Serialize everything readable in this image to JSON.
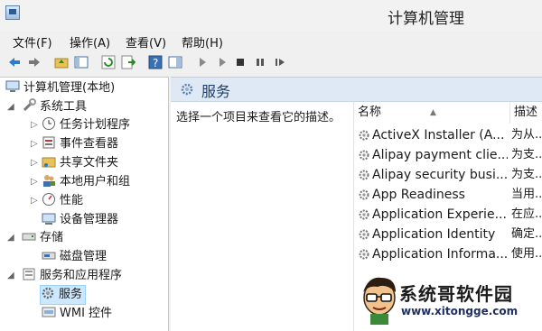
{
  "window": {
    "title": "计算机管理"
  },
  "menu": [
    "文件(F)",
    "操作(A)",
    "查看(V)",
    "帮助(H)"
  ],
  "tree": {
    "root": "计算机管理(本地)",
    "system_tools": "系统工具",
    "task_scheduler": "任务计划程序",
    "event_viewer": "事件查看器",
    "shared_folders": "共享文件夹",
    "local_users": "本地用户和组",
    "performance": "性能",
    "device_manager": "设备管理器",
    "storage": "存储",
    "disk_management": "磁盘管理",
    "services_apps": "服务和应用程序",
    "services": "服务",
    "wmi": "WMI 控件"
  },
  "services_panel": {
    "title": "服务",
    "description": "选择一个项目来查看它的描述。",
    "columns": {
      "name": "名称",
      "desc": "描述"
    },
    "rows": [
      {
        "name": "ActiveX Installer (A...",
        "desc": "为从..."
      },
      {
        "name": "Alipay payment clie...",
        "desc": "为支..."
      },
      {
        "name": "Alipay security busi...",
        "desc": "为支..."
      },
      {
        "name": "App Readiness",
        "desc": "当用..."
      },
      {
        "name": "Application Experie...",
        "desc": "在应..."
      },
      {
        "name": "Application Identity",
        "desc": "确定..."
      },
      {
        "name": "Application Informa...",
        "desc": "使用..."
      }
    ]
  },
  "watermark": {
    "title": "系统哥软件园",
    "url": "www.xitongge.com"
  }
}
